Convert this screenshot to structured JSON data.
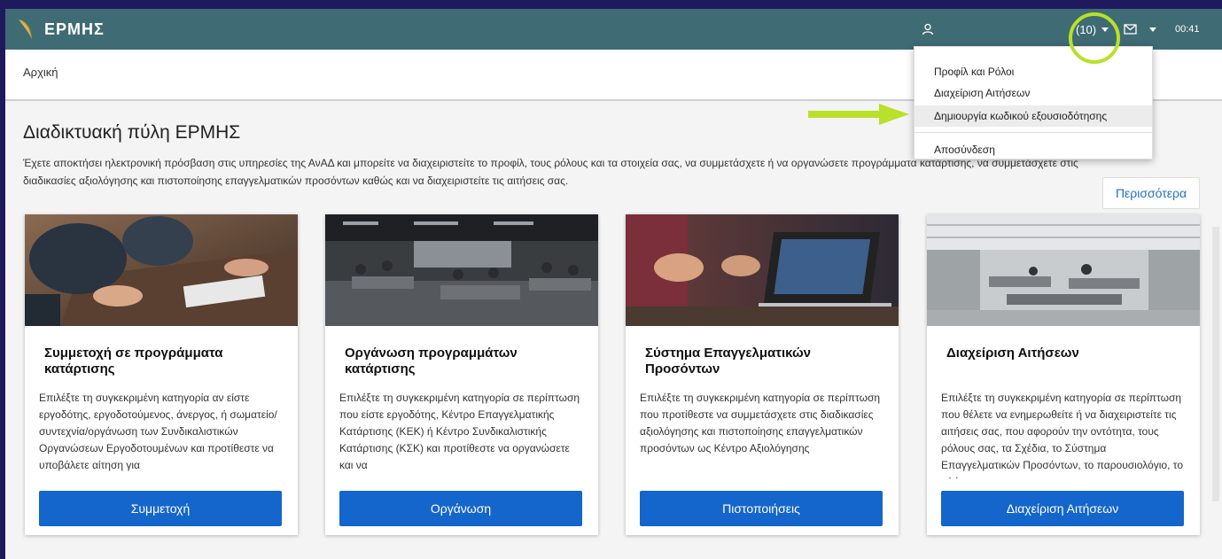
{
  "app": {
    "name": "ΕΡΜΗΣ"
  },
  "topbar": {
    "notifications_count": "(10)",
    "time": "00:41",
    "icons": {
      "user": "user-icon",
      "mail": "mail-icon",
      "logo": "hermes-feather-logo"
    }
  },
  "dropdown": {
    "items": [
      {
        "label": "Προφίλ και Ρόλοι"
      },
      {
        "label": "Διαχείριση Αιτήσεων"
      },
      {
        "label": "Δημιουργία κωδικού εξουσιοδότησης"
      },
      {
        "label": "Αποσύνδεση"
      }
    ]
  },
  "breadcrumb": {
    "home": "Αρχική"
  },
  "page": {
    "title": "Διαδικτυακή πύλη ΕΡΜΗΣ",
    "description": "Έχετε αποκτήσει ηλεκτρονική πρόσβαση στις υπηρεσίες της ΑνΑΔ και μπορείτε να διαχειριστείτε το προφίλ, τους ρόλους και τα στοιχεία σας, να συμμετάσχετε ή να οργανώσετε προγράμματα κατάρτισης, να συμμετάσχετε στις διαδικασίες αξιολόγησης και πιστοποίησης επαγγελματικών προσόντων καθώς και να διαχειριστείτε τις αιτήσεις σας.",
    "more_label": "Περισσότερα"
  },
  "cards": [
    {
      "title": "Συμμετοχή σε προγράμματα κατάρτισης",
      "text": "Επιλέξτε τη συγκεκριμένη κατηγορία αν είστε εργοδότης, εργοδοτούμενος, άνεργος, ή σωματείο/συντεχνία/οργάνωση των Συνδικαλιστικών Οργανώσεων Εργοδοτουμένων και προτίθεστε να υποβάλετε αίτηση για",
      "button": "Συμμετοχή"
    },
    {
      "title": "Οργάνωση προγραμμάτων κατάρτισης",
      "text": "Επιλέξτε τη συγκεκριμένη κατηγορία σε περίπτωση που είστε εργοδότης, Κέντρο Επαγγελματικής Κατάρτισης (ΚΕΚ) ή Κέντρο Συνδικαλιστικής Κατάρτισης (ΚΣΚ) και προτίθεστε να οργανώσετε και να",
      "button": "Οργάνωση"
    },
    {
      "title": "Σύστημα Επαγγελματικών Προσόντων",
      "text": "Επιλέξτε τη συγκεκριμένη κατηγορία σε περίπτωση που προτίθεστε να συμμετάσχετε στις διαδικασίες αξιολόγησης και πιστοποίησης επαγγελματικών προσόντων ως Κέντρο Αξιολόγησης",
      "button": "Πιστοποιήσεις"
    },
    {
      "title": "Διαχείριση Αιτήσεων",
      "text": "Επιλέξτε τη συγκεκριμένη κατηγορία σε περίπτωση που θέλετε να ενημερωθείτε ή να διαχειριστείτε τις αιτήσεις σας, που αφορούν την οντότητα, τους ρόλους σας, τα Σχέδια, το Σύστημα Επαγγελματικών Προσόντων, το παρουσιολόγιο, το πλάνο",
      "button": "Διαχείριση Αιτήσεων"
    }
  ],
  "colors": {
    "topbar": "#3f6b74",
    "button": "#1466cc",
    "highlight": "#b9e02a",
    "frame": "#1f1a5e"
  }
}
